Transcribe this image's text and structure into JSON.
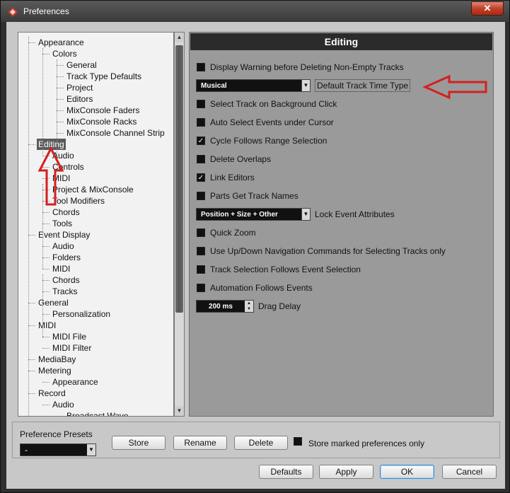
{
  "window": {
    "title": "Preferences",
    "close_label": "✕"
  },
  "tree": {
    "items": [
      {
        "label": "Appearance",
        "level": 0
      },
      {
        "label": "Colors",
        "level": 1
      },
      {
        "label": "General",
        "level": 2
      },
      {
        "label": "Track Type Defaults",
        "level": 2
      },
      {
        "label": "Project",
        "level": 2
      },
      {
        "label": "Editors",
        "level": 2
      },
      {
        "label": "MixConsole Faders",
        "level": 2
      },
      {
        "label": "MixConsole Racks",
        "level": 2
      },
      {
        "label": "MixConsole Channel Strip",
        "level": 2
      },
      {
        "label": "Editing",
        "level": 0,
        "selected": true
      },
      {
        "label": "Audio",
        "level": 1
      },
      {
        "label": "Controls",
        "level": 1
      },
      {
        "label": "MIDI",
        "level": 1
      },
      {
        "label": "Project & MixConsole",
        "level": 1
      },
      {
        "label": "Tool Modifiers",
        "level": 1
      },
      {
        "label": "Chords",
        "level": 1
      },
      {
        "label": "Tools",
        "level": 1
      },
      {
        "label": "Event Display",
        "level": 0
      },
      {
        "label": "Audio",
        "level": 1
      },
      {
        "label": "Folders",
        "level": 1
      },
      {
        "label": "MIDI",
        "level": 1
      },
      {
        "label": "Chords",
        "level": 1
      },
      {
        "label": "Tracks",
        "level": 1
      },
      {
        "label": "General",
        "level": 0
      },
      {
        "label": "Personalization",
        "level": 1
      },
      {
        "label": "MIDI",
        "level": 0
      },
      {
        "label": "MIDI File",
        "level": 1
      },
      {
        "label": "MIDI Filter",
        "level": 1
      },
      {
        "label": "MediaBay",
        "level": 0
      },
      {
        "label": "Metering",
        "level": 0
      },
      {
        "label": "Appearance",
        "level": 1
      },
      {
        "label": "Record",
        "level": 0
      },
      {
        "label": "Audio",
        "level": 1
      },
      {
        "label": "Broadcast Wave",
        "level": 2
      }
    ]
  },
  "panel": {
    "title": "Editing",
    "options": [
      {
        "kind": "checkbox",
        "label": "Display Warning before Deleting Non-Empty Tracks",
        "checked": false
      },
      {
        "kind": "dropdown",
        "value": "Musical",
        "label": "Default Track Time Type"
      },
      {
        "kind": "checkbox",
        "label": "Select Track on Background Click",
        "checked": false
      },
      {
        "kind": "checkbox",
        "label": "Auto Select Events under Cursor",
        "checked": false
      },
      {
        "kind": "checkbox",
        "label": "Cycle Follows Range Selection",
        "checked": true
      },
      {
        "kind": "checkbox",
        "label": "Delete Overlaps",
        "checked": false
      },
      {
        "kind": "checkbox",
        "label": "Link Editors",
        "checked": true
      },
      {
        "kind": "checkbox",
        "label": "Parts Get Track Names",
        "checked": false
      },
      {
        "kind": "dropdown",
        "value": "Position + Size + Other",
        "label": "Lock Event Attributes"
      },
      {
        "kind": "checkbox",
        "label": "Quick Zoom",
        "checked": false
      },
      {
        "kind": "checkbox",
        "label": "Use Up/Down Navigation Commands for Selecting Tracks only",
        "checked": false
      },
      {
        "kind": "checkbox",
        "label": "Track Selection Follows Event Selection",
        "checked": false
      },
      {
        "kind": "checkbox",
        "label": "Automation Follows Events",
        "checked": false
      },
      {
        "kind": "spinner",
        "value": "200 ms",
        "label": "Drag Delay"
      }
    ]
  },
  "presets": {
    "label": "Preference Presets",
    "selected": "-",
    "store_label": "Store",
    "rename_label": "Rename",
    "delete_label": "Delete",
    "store_marked_label": "Store marked preferences only"
  },
  "footer": {
    "defaults_label": "Defaults",
    "apply_label": "Apply",
    "ok_label": "OK",
    "cancel_label": "Cancel"
  },
  "colors": {
    "annotation_arrow": "#d42020",
    "selected_bg": "#5a5a5a",
    "header_bg": "#2b2b2b"
  }
}
